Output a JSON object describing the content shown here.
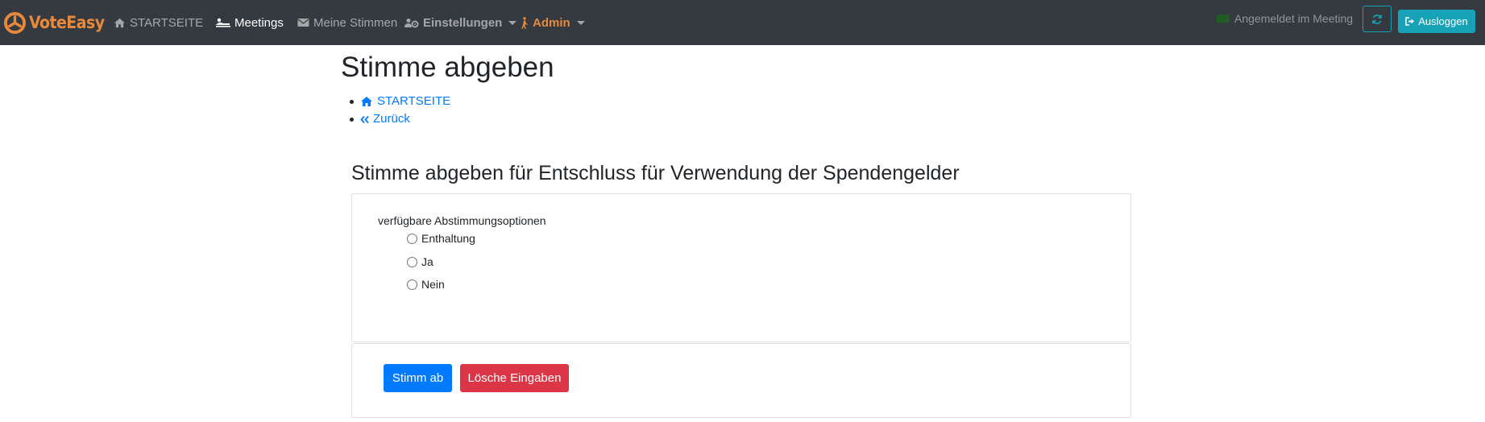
{
  "navbar": {
    "brand": "VoteEasy",
    "items": [
      {
        "label": "STARTSEITE"
      },
      {
        "label": "Meetings"
      },
      {
        "label": "Meine Stimmen"
      },
      {
        "label": "Einstellungen"
      },
      {
        "label": "Admin"
      }
    ],
    "status_text": "Angemeldet im Meeting",
    "logout_label": "Ausloggen"
  },
  "page": {
    "title": "Stimme abgeben",
    "breadcrumbs": [
      {
        "label": "STARTSEITE"
      },
      {
        "label": "Zurück"
      }
    ],
    "section_title": "Stimme abgeben für Entschluss für Verwendung der Spendengelder",
    "options_label": "verfügbare Abstimmungsoptionen",
    "options": [
      {
        "label": "Enthaltung"
      },
      {
        "label": "Ja"
      },
      {
        "label": "Nein"
      }
    ],
    "submit_label": "Stimm ab",
    "reset_label": "Lösche Eingaben"
  },
  "colors": {
    "navbar_bg": "#343a40",
    "brand": "#e8893b",
    "primary": "#007bff",
    "danger": "#dc3545",
    "info": "#17a2b8",
    "status_dot": "#1f5d24"
  }
}
